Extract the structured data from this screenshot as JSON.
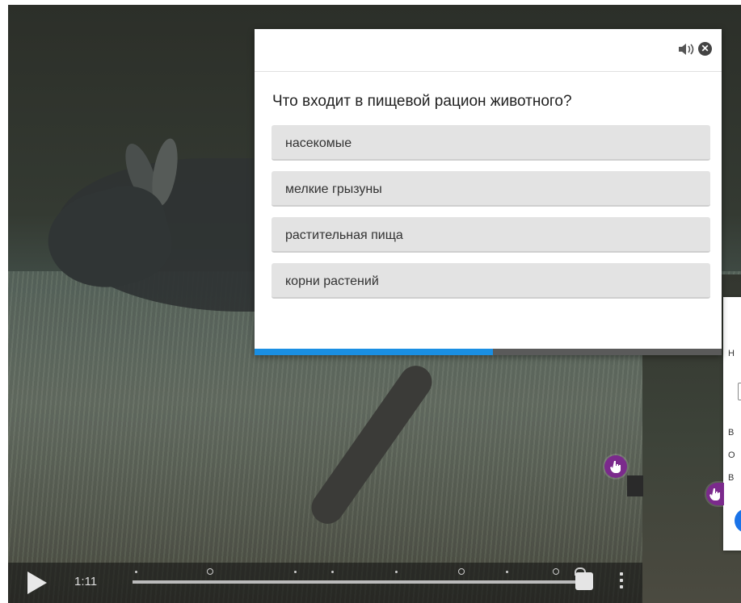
{
  "quiz": {
    "question": "Что входит в пищевой рацион животного?",
    "answers": [
      "насекомые",
      "мелкие грызуны",
      "растительная пища",
      "корни растений"
    ],
    "progress_fraction": 0.51,
    "sound_icon": "volume-icon",
    "close_icon": "close-icon"
  },
  "player": {
    "time": "1:11",
    "play_icon": "play-icon",
    "menu_icon": "more-vertical-icon",
    "seek_progress_fraction": 1.0
  },
  "second_card": {
    "letters": [
      "Н",
      "В",
      "О",
      "В"
    ]
  },
  "colors": {
    "accent_progress": "#1a8fe3",
    "hotspot": "#7b2a8c",
    "answer_bg": "#e3e3e3"
  }
}
